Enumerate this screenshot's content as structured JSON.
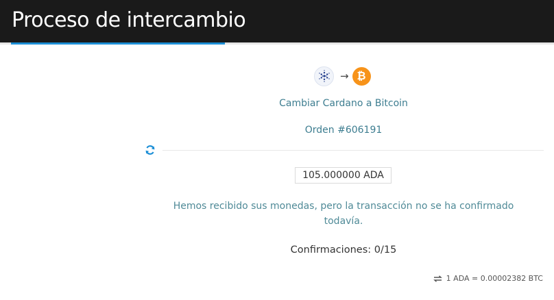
{
  "header": {
    "title": "Proceso de intercambio"
  },
  "exchange": {
    "from_icon": "cardano-icon",
    "to_icon": "bitcoin-icon",
    "arrow": "→",
    "title": "Cambiar Cardano a Bitcoin",
    "order": "Orden #606191",
    "amount": "105.000000 ADA",
    "status_message": "Hemos recibido sus monedas, pero la transacción no se ha confirmado todavía.",
    "confirmations": "Confirmaciones: 0/15",
    "rate": "1 ADA = 0.00002382 BTC"
  },
  "colors": {
    "header_bg": "#1a1a1a",
    "accent": "#1d8fd6",
    "text_teal": "#3d7d90",
    "bitcoin_orange": "#f7931a"
  }
}
